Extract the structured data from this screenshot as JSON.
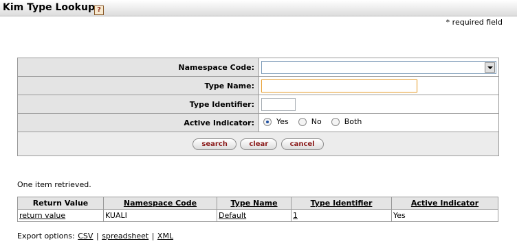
{
  "header": {
    "title": "Kim Type Lookup",
    "help_icon": "?"
  },
  "required_note": "* required field",
  "criteria": {
    "namespace_code_label": "Namespace Code:",
    "type_name_label": "Type Name:",
    "type_identifier_label": "Type Identifier:",
    "active_indicator_label": "Active Indicator:",
    "namespace_code_value": "",
    "type_name_value": "",
    "type_identifier_value": "",
    "active_options": [
      "Yes",
      "No",
      "Both"
    ],
    "active_selected": "Yes"
  },
  "buttons": {
    "search": "search",
    "clear": "clear",
    "cancel": "cancel"
  },
  "results": {
    "count_text": "One item retrieved.",
    "columns": [
      "Return Value",
      "Namespace Code",
      "Type Name",
      "Type Identifier",
      "Active Indicator"
    ],
    "rows": [
      [
        "return value",
        "KUALI",
        "Default",
        "1",
        "Yes"
      ]
    ]
  },
  "export": {
    "label": "Export options:",
    "options": [
      "CSV",
      "spreadsheet",
      "XML"
    ],
    "separator": "|"
  },
  "colors": {
    "label_bg": "#e4e4e4",
    "border": "#999999",
    "button_text": "#8b1a1a",
    "focus_border": "#e8a33d"
  }
}
